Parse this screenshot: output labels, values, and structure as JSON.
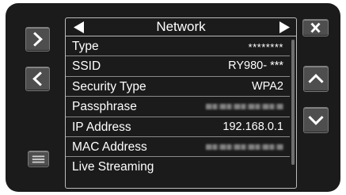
{
  "header": {
    "title": "Network"
  },
  "rows": [
    {
      "label": "Type",
      "value": "********"
    },
    {
      "label": "SSID",
      "value": "RY980- ***"
    },
    {
      "label": "Security Type",
      "value": "WPA2"
    },
    {
      "label": "Passphrase",
      "value": ""
    },
    {
      "label": "IP Address",
      "value": "192.168.0.1"
    },
    {
      "label": "MAC Address",
      "value": ""
    },
    {
      "label": "Live Streaming",
      "value": ""
    }
  ],
  "icons": {
    "next_page": "chevron-right-icon",
    "prev_page": "chevron-left-icon",
    "menu": "menu-icon",
    "close": "close-icon",
    "scroll_up": "chevron-up-icon",
    "scroll_down": "chevron-down-icon",
    "header_prev": "triangle-left-icon",
    "header_next": "triangle-right-icon"
  },
  "colors": {
    "background": "#1b1b1b",
    "button": "#4e4e4e",
    "text": "#ffffff"
  }
}
